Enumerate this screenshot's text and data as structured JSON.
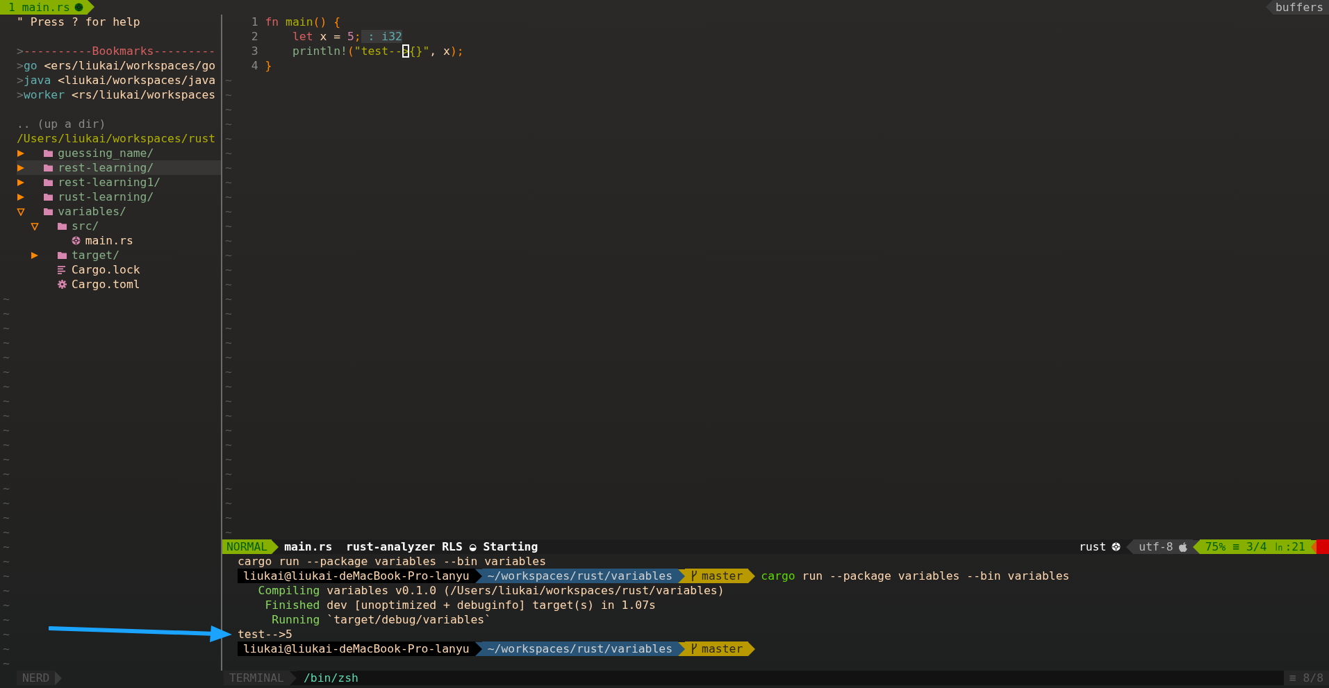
{
  "tabline": {
    "tabs": [
      {
        "label": "1 main.rs",
        "selected": true
      }
    ],
    "buffers_label": "buffers"
  },
  "file_tree": {
    "help": "\" Press ? for help",
    "bookmarks_header": {
      "marker": ">",
      "text": "----------Bookmarks---------"
    },
    "bookmarks": [
      {
        "marker": ">",
        "name": "go",
        "path": "<ers/liukai/workspaces/go"
      },
      {
        "marker": ">",
        "name": "java",
        "path": "<liukai/workspaces/java"
      },
      {
        "marker": ">",
        "name": "worker",
        "path": "<rs/liukai/workspaces"
      }
    ],
    "up_dir": ".. (up a dir)",
    "root": "/Users/liukai/workspaces/rust",
    "items": [
      {
        "name": "guessing_name/",
        "kind": "dir",
        "expanded": false,
        "selected": false
      },
      {
        "name": "rest-learning/",
        "kind": "dir",
        "expanded": false,
        "selected": true
      },
      {
        "name": "rest-learning1/",
        "kind": "dir",
        "expanded": false,
        "selected": false
      },
      {
        "name": "rust-learning/",
        "kind": "dir",
        "expanded": false,
        "selected": false
      },
      {
        "name": "variables/",
        "kind": "dir",
        "expanded": true,
        "selected": false,
        "children": [
          {
            "name": "src/",
            "kind": "dir",
            "expanded": true,
            "selected": false,
            "children": [
              {
                "name": "main.rs",
                "kind": "rust",
                "selected": false
              }
            ]
          },
          {
            "name": "target/",
            "kind": "dir",
            "expanded": false,
            "selected": false
          },
          {
            "name": "Cargo.lock",
            "kind": "lock",
            "selected": false
          },
          {
            "name": "Cargo.toml",
            "kind": "config",
            "selected": false
          }
        ]
      }
    ],
    "filler": [
      "~",
      "~",
      "~",
      "~",
      "~",
      "~",
      "~",
      "~",
      "~",
      "~",
      "~",
      "~",
      "~",
      "~",
      "~",
      "~",
      "~",
      "~",
      "~",
      "~",
      "~",
      "~",
      "~",
      "~",
      "~",
      "~"
    ]
  },
  "editor": {
    "lines": [
      {
        "number": "1",
        "tokens": [
          {
            "text": "fn ",
            "kind": "keyword"
          },
          {
            "text": "main",
            "kind": "function"
          },
          {
            "text": "() {",
            "kind": "punct"
          }
        ]
      },
      {
        "number": "2",
        "tokens": [
          {
            "text": "    let ",
            "kind": "keyword"
          },
          {
            "text": "x = ",
            "kind": "ident"
          },
          {
            "text": "5",
            "kind": "number"
          },
          {
            "text": ";",
            "kind": "punct"
          },
          {
            "text": " : i32",
            "kind": "hint"
          }
        ]
      },
      {
        "number": "3",
        "tokens": [
          {
            "text": "    println!",
            "kind": "macro"
          },
          {
            "text": "(",
            "kind": "punct"
          },
          {
            "text": "\"test--",
            "kind": "string"
          },
          {
            "text": ">",
            "kind": "string",
            "cursor": true
          },
          {
            "text": "{}\"",
            "kind": "string"
          },
          {
            "text": ", x",
            "kind": "ident"
          },
          {
            "text": ");",
            "kind": "punct"
          }
        ]
      },
      {
        "number": "4",
        "tokens": [
          {
            "text": "}",
            "kind": "punct"
          }
        ]
      }
    ],
    "filler": [
      "~",
      "~",
      "~",
      "~",
      "~",
      "~",
      "~",
      "~",
      "~",
      "~",
      "~",
      "~",
      "~",
      "~",
      "~",
      "~",
      "~",
      "~",
      "~",
      "~",
      "~",
      "~",
      "~",
      "~",
      "~",
      "~",
      "~",
      "~",
      "~",
      "~",
      "~",
      "~"
    ]
  },
  "statusline": {
    "mode": "NORMAL",
    "file": "main.rs",
    "lsp": "rust-analyzer RLS",
    "spinner": "◒",
    "lsp_status": "Starting",
    "filetype": "rust",
    "encoding": "utf-8",
    "percent": "75%",
    "lines_symbol": "≡",
    "lines": "3/4",
    "column_symbol": "㏑",
    "column": ":21"
  },
  "terminal": {
    "lines": [
      {
        "kind": "command",
        "text": "cargo run --package variables --bin variables"
      },
      {
        "kind": "prompt",
        "user": "liukai@liukai-deMacBook-Pro-lanyu",
        "path": "~/workspaces/rust/variables",
        "branch": "master",
        "command_name": "cargo",
        "command_args": "run --package variables --bin variables"
      },
      {
        "kind": "cargo",
        "status": "Compiling",
        "text": "variables v0.1.0 (/Users/liukai/workspaces/rust/variables)"
      },
      {
        "kind": "cargo",
        "status": "Finished",
        "text": "dev [unoptimized + debuginfo] target(s) in 1.07s"
      },
      {
        "kind": "cargo",
        "status": "Running",
        "text": "`target/debug/variables`"
      },
      {
        "kind": "output",
        "text": "test-->5"
      },
      {
        "kind": "prompt",
        "user": "liukai@liukai-deMacBook-Pro-lanyu",
        "path": "~/workspaces/rust/variables",
        "branch": "master"
      }
    ]
  },
  "bottom": {
    "tree_label": "NERD",
    "terminal_label": "TERMINAL",
    "shell": "/bin/zsh",
    "position_symbol": "≡",
    "position": "8/8"
  }
}
